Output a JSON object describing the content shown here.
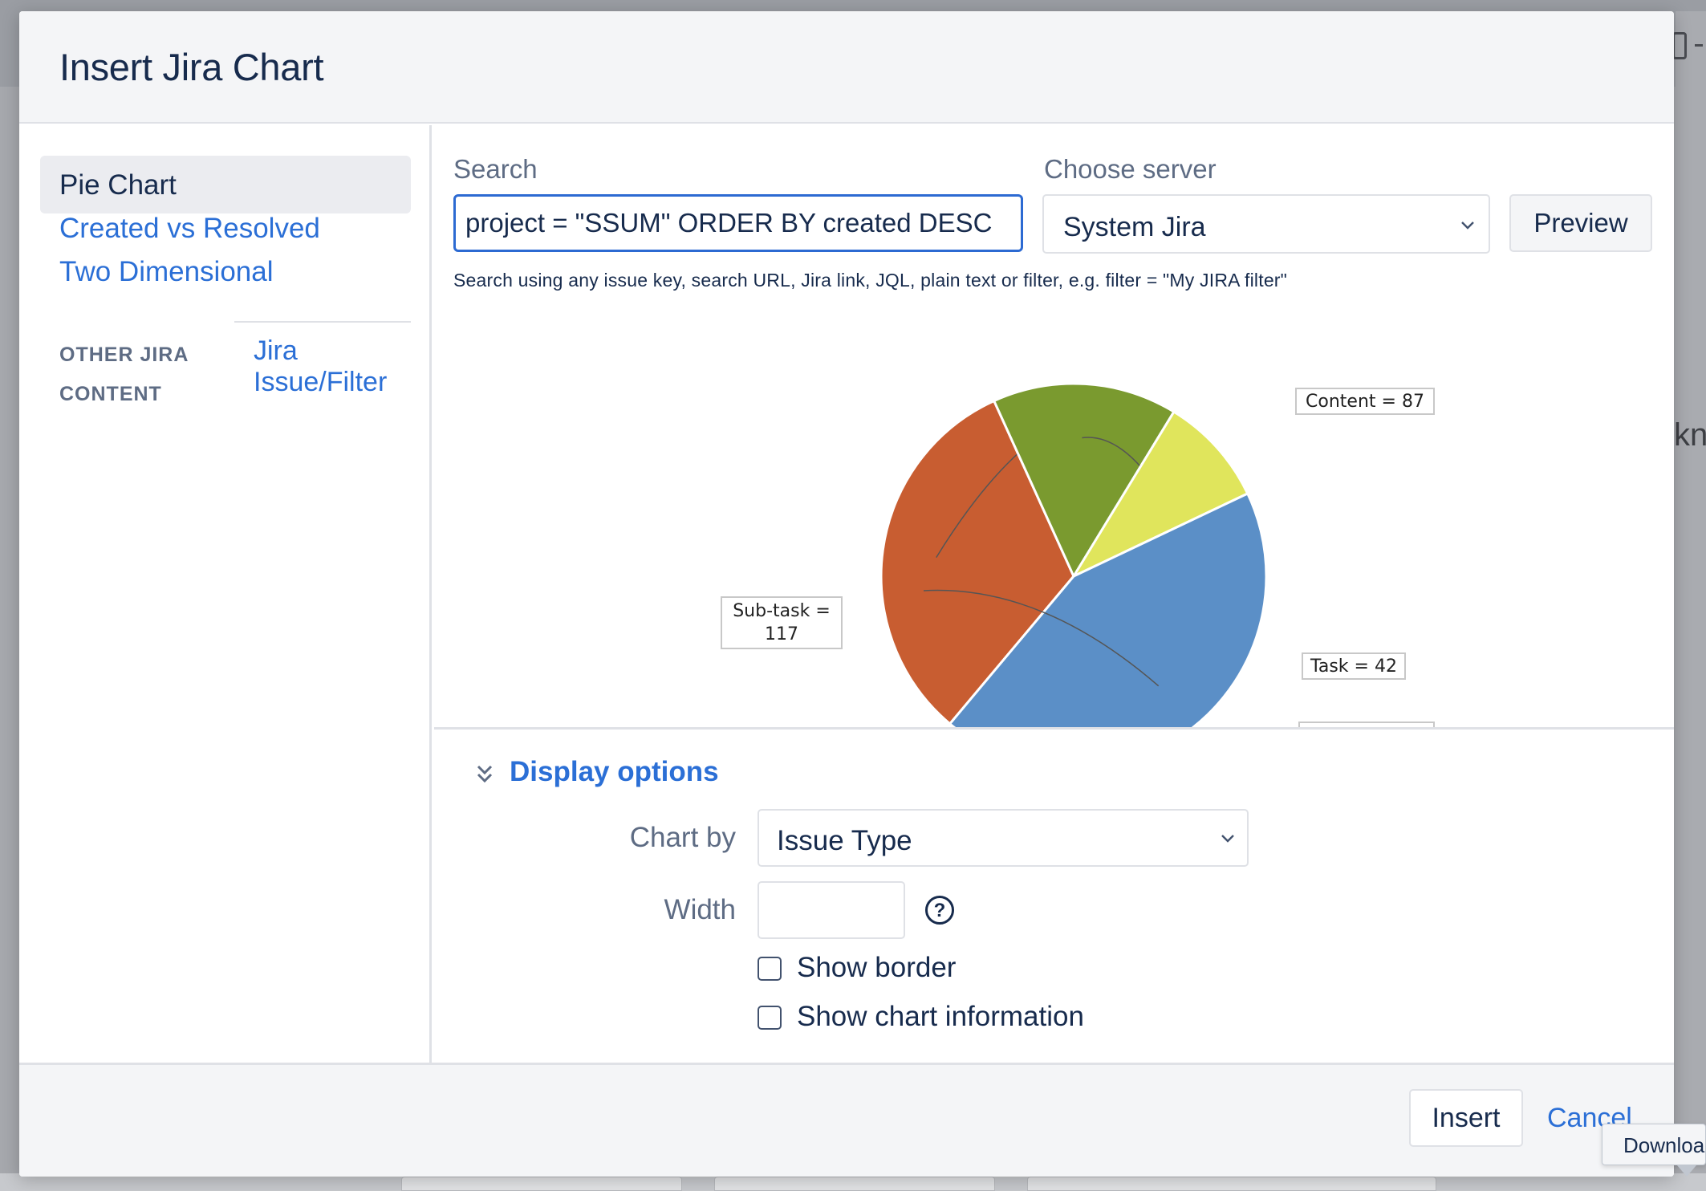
{
  "dialog": {
    "title": "Insert Jira Chart"
  },
  "sidebar": {
    "items": [
      {
        "label": "Pie Chart",
        "active": true
      },
      {
        "label": "Created vs Resolved",
        "active": false
      },
      {
        "label": "Two Dimensional",
        "active": false
      }
    ],
    "section_title": "OTHER JIRA CONTENT",
    "section_link": "Jira Issue/Filter"
  },
  "search": {
    "label": "Search",
    "value": "project = \"SSUM\" ORDER BY created DESC",
    "help": "Search using any issue key, search URL, Jira link, JQL, plain text or filter, e.g. filter = \"My JIRA filter\""
  },
  "server": {
    "label": "Choose server",
    "selected": "System Jira"
  },
  "preview_label": "Preview",
  "chart_data": {
    "type": "pie",
    "title": "",
    "slices": [
      {
        "label": "Content",
        "value": 87,
        "label_text": "Content = 87",
        "color": "#c85d31"
      },
      {
        "label": "Task",
        "value": 42,
        "label_text": "Task = 42",
        "color": "#7a9a2f"
      },
      {
        "label": "",
        "value": null,
        "label_text": "",
        "color": "#e0e55c"
      },
      {
        "label": "Sub-task",
        "value": 117,
        "label_text": "Sub-task = 117",
        "color": "#5b8fc7"
      }
    ]
  },
  "display_options": {
    "toggle_label": "Display options",
    "chart_by_label": "Chart by",
    "chart_by_value": "Issue Type",
    "width_label": "Width",
    "width_value": "",
    "help_symbol": "?",
    "show_border_label": "Show border",
    "show_border_checked": false,
    "show_chart_info_label": "Show chart information",
    "show_chart_info_checked": false
  },
  "footer": {
    "insert_label": "Insert",
    "cancel_label": "Cancel"
  },
  "background": {
    "right_fragment": "kno",
    "tooltip": "Download"
  },
  "colors": {
    "link": "#2b6fd6",
    "focus": "#2c6ad2",
    "text": "#172b4d",
    "muted": "#5e6c84"
  }
}
